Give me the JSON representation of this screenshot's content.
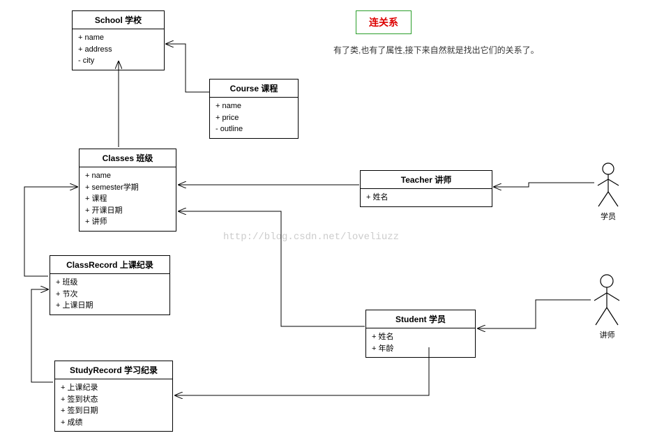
{
  "title": "连关系",
  "description": "有了类,也有了属性,接下来自然就是找出它们的关系了。",
  "watermark": "http://blog.csdn.net/loveliuzz",
  "classes": {
    "school": {
      "name": "School 学校",
      "attrs": [
        "+ name",
        "+ address",
        "- city"
      ]
    },
    "course": {
      "name": "Course 课程",
      "attrs": [
        "+ name",
        "+ price",
        "- outline"
      ]
    },
    "classes": {
      "name": "Classes 班级",
      "attrs": [
        "+ name",
        "+ semester学期",
        "+ 课程",
        "+ 开课日期",
        "+ 讲师"
      ]
    },
    "teacher": {
      "name": "Teacher 讲师",
      "attrs": [
        "+ 姓名"
      ]
    },
    "classrecord": {
      "name": "ClassRecord 上课纪录",
      "attrs": [
        "+ 班级",
        "+ 节次",
        "+ 上课日期"
      ]
    },
    "student": {
      "name": "Student 学员",
      "attrs": [
        "+ 姓名",
        "+ 年龄"
      ]
    },
    "studyrecord": {
      "name": "StudyRecord 学习纪录",
      "attrs": [
        "+ 上课纪录",
        "+ 签到状态",
        "+ 签到日期",
        "+ 成绩"
      ]
    }
  },
  "actors": {
    "top": "学员",
    "bottom": "讲师"
  }
}
